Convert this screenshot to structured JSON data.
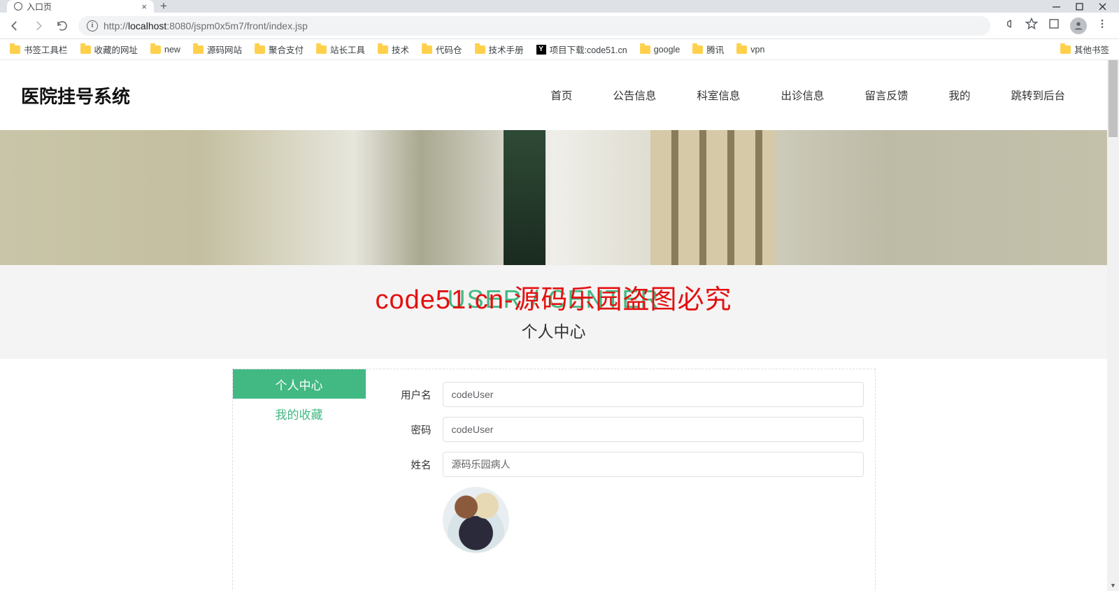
{
  "browser": {
    "tab_title": "入口页",
    "url_host": "localhost",
    "url_port": ":8080",
    "url_path": "/jspm0x5m7/front/index.jsp",
    "url_prefix": "http://"
  },
  "bookmarks": {
    "items": [
      "书签工具栏",
      "收藏的网址",
      "new",
      "源码网站",
      "聚合支付",
      "站长工具",
      "技术",
      "代码仓",
      "技术手册"
    ],
    "project_dl": "项目下载:code51.cn",
    "items2": [
      "google",
      "腾讯",
      "vpn"
    ],
    "other": "其他书签"
  },
  "site": {
    "logo": "医院挂号系统",
    "nav": [
      "首页",
      "公告信息",
      "科室信息",
      "出诊信息",
      "留言反馈",
      "我的",
      "跳转到后台"
    ]
  },
  "section": {
    "title_en": "USER / CENTER",
    "title_cn": "个人中心",
    "watermark": "code51.cn-源码乐园盗图必究"
  },
  "sidemenu": {
    "personal": "个人中心",
    "fav": "我的收藏"
  },
  "form": {
    "username_label": "用户名",
    "username_value": "codeUser",
    "password_label": "密码",
    "password_value": "codeUser",
    "name_label": "姓名",
    "name_value": "源码乐园病人"
  }
}
